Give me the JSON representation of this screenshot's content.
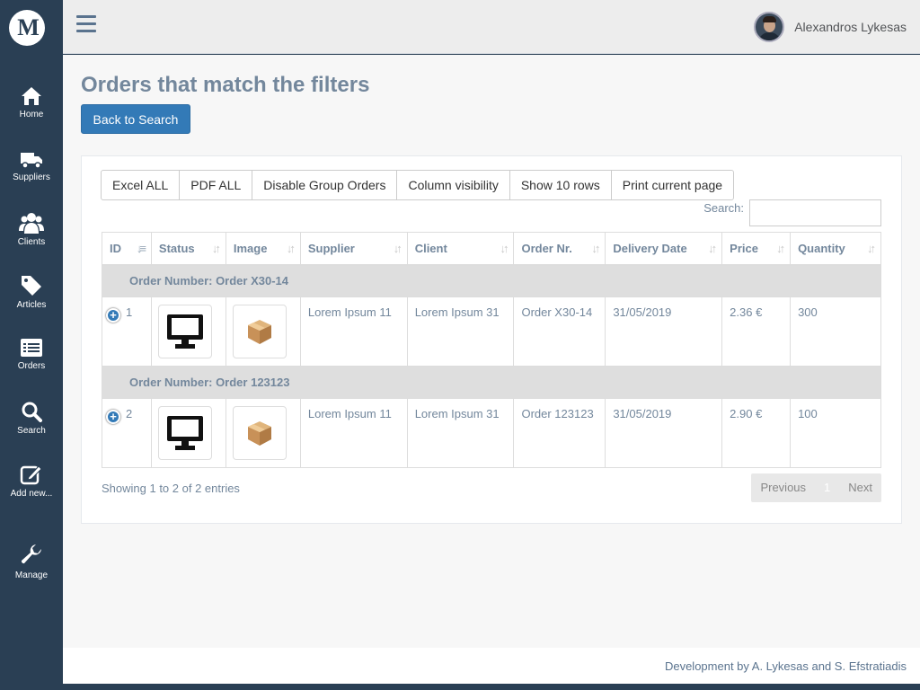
{
  "app": {
    "logo_text": "M"
  },
  "sidebar": {
    "items": [
      {
        "label": "Home",
        "icon": "home-icon"
      },
      {
        "label": "Suppliers",
        "icon": "truck-icon"
      },
      {
        "label": "Clients",
        "icon": "users-icon"
      },
      {
        "label": "Articles",
        "icon": "tag-icon"
      },
      {
        "label": "Orders",
        "icon": "list-icon"
      },
      {
        "label": "Search",
        "icon": "search-icon"
      },
      {
        "label": "Add new...",
        "icon": "edit-icon"
      },
      {
        "label": "Manage",
        "icon": "wrench-icon"
      }
    ]
  },
  "header": {
    "user_name": "Alexandros Lykesas"
  },
  "main": {
    "title": "Orders that match the filters",
    "back_button": "Back to Search",
    "toolbar": {
      "excel": "Excel ALL",
      "pdf": "PDF ALL",
      "group": "Disable Group Orders",
      "columns": "Column visibility",
      "rows": "Show 10 rows",
      "print": "Print current page"
    },
    "search_label": "Search:",
    "search_value": "",
    "columns": [
      "ID",
      "Status",
      "Image",
      "Supplier",
      "Client",
      "Order Nr.",
      "Delivery Date",
      "Price",
      "Quantity"
    ],
    "groups": [
      {
        "label": "Order Number: Order X30-14",
        "row": {
          "id": "1",
          "supplier": "Lorem Ipsum 11",
          "client": "Lorem Ipsum 31",
          "order_nr": "Order X30-14",
          "date": "31/05/2019",
          "price": "2.36 €",
          "quantity": "300"
        }
      },
      {
        "label": "Order Number: Order 123123",
        "row": {
          "id": "2",
          "supplier": "Lorem Ipsum 11",
          "client": "Lorem Ipsum 31",
          "order_nr": "Order 123123",
          "date": "31/05/2019",
          "price": "2.90 €",
          "quantity": "100"
        }
      }
    ],
    "info": "Showing 1 to 2 of 2 entries",
    "pagination": {
      "previous": "Previous",
      "current": "1",
      "next": "Next"
    }
  },
  "footer": {
    "text": "Development by A. Lykesas and S. Efstratiadis"
  },
  "colors": {
    "sidebar": "#2a3f54",
    "primary": "#337ab7",
    "text": "#73879c"
  }
}
